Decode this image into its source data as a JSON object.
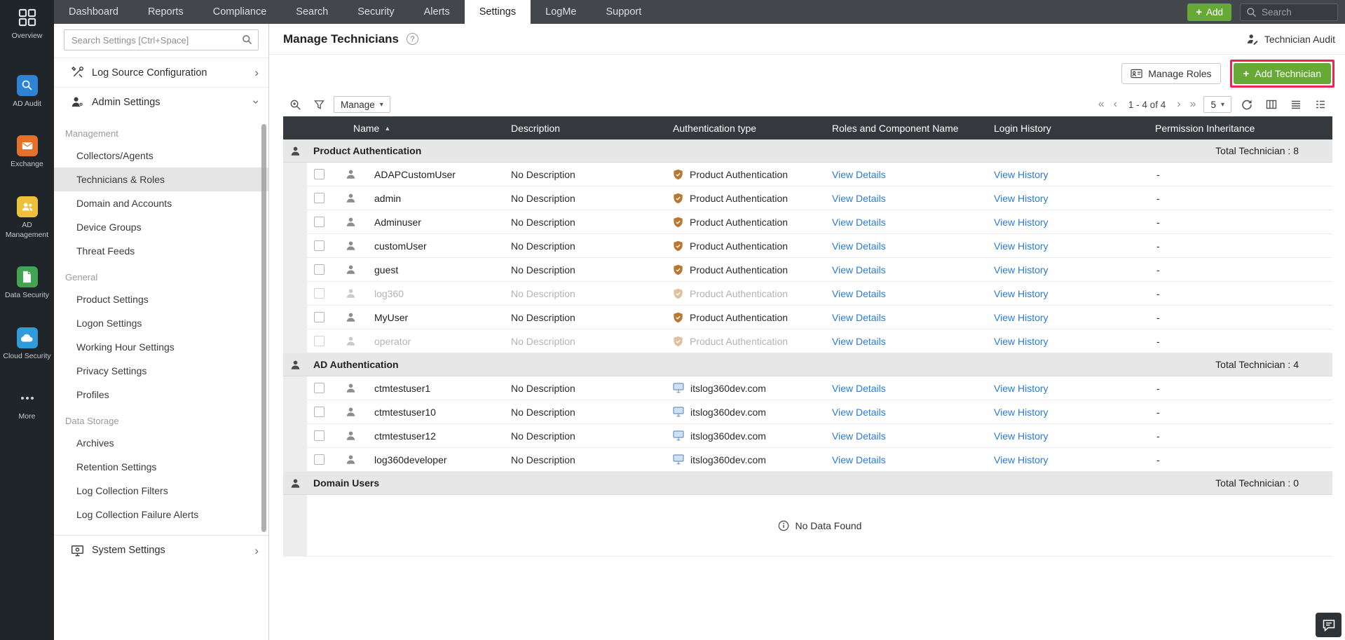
{
  "colors": {
    "accent_green": "#67a936",
    "highlight_red": "#f2244e",
    "link_blue": "#2b7bd3",
    "topbar_dark": "#43474b",
    "rail_dark": "#20252a",
    "table_header_dark": "#35393d"
  },
  "topnav": {
    "tabs": [
      {
        "label": "Dashboard",
        "active": false
      },
      {
        "label": "Reports",
        "active": false
      },
      {
        "label": "Compliance",
        "active": false
      },
      {
        "label": "Search",
        "active": false
      },
      {
        "label": "Security",
        "active": false
      },
      {
        "label": "Alerts",
        "active": false
      },
      {
        "label": "Settings",
        "active": true
      },
      {
        "label": "LogMe",
        "active": false
      },
      {
        "label": "Support",
        "active": false
      }
    ],
    "add_button_label": "Add",
    "search_placeholder": "Search"
  },
  "rail": {
    "items": [
      {
        "label": "Overview",
        "icon": "grid-icon",
        "color": ""
      },
      {
        "label": "AD Audit",
        "icon": "ad-audit-icon",
        "color": "#2e83d4"
      },
      {
        "label": "Exchange",
        "icon": "exchange-icon",
        "color": "#e5702a"
      },
      {
        "label": "AD Management",
        "icon": "ad-management-icon",
        "color": "#eec13c"
      },
      {
        "label": "Data Security",
        "icon": "data-security-icon",
        "color": "#43a353"
      },
      {
        "label": "Cloud Security",
        "icon": "cloud-security-icon",
        "color": "#2f9bd8"
      },
      {
        "label": "More",
        "icon": "more-icon",
        "color": ""
      }
    ]
  },
  "sidebar": {
    "search_placeholder": "Search Settings [Ctrl+Space]",
    "groups_top": [
      {
        "label": "Log Source Configuration",
        "icon": "tools-icon",
        "chevron": "right"
      },
      {
        "label": "Admin Settings",
        "icon": "admin-user-icon",
        "chevron": "down"
      }
    ],
    "active_item": "Technicians & Roles",
    "sections": [
      {
        "label": "Management",
        "items": [
          "Collectors/Agents",
          "Technicians & Roles",
          "Domain and Accounts",
          "Device Groups",
          "Threat Feeds"
        ]
      },
      {
        "label": "General",
        "items": [
          "Product Settings",
          "Logon Settings",
          "Working Hour Settings",
          "Privacy Settings",
          "Profiles"
        ]
      },
      {
        "label": "Data Storage",
        "items": [
          "Archives",
          "Retention Settings",
          "Log Collection Filters",
          "Log Collection Failure Alerts"
        ]
      }
    ],
    "groups_bottom": [
      {
        "label": "System Settings",
        "icon": "system-settings-icon",
        "chevron": "right"
      }
    ]
  },
  "page": {
    "title": "Manage Technicians",
    "technician_audit_label": "Technician Audit",
    "manage_roles_label": "Manage Roles",
    "add_technician_label": "Add Technician",
    "toolbar": {
      "manage_label": "Manage",
      "pagination_label": "1 - 4 of 4",
      "page_size": "5",
      "first_glyph": "«",
      "prev_glyph": "‹",
      "next_glyph": "›",
      "last_glyph": "»"
    },
    "table": {
      "columns": [
        "Name",
        "Description",
        "Authentication type",
        "Roles and Component Name",
        "Login History",
        "Permission Inheritance"
      ],
      "groups": [
        {
          "label": "Product Authentication",
          "total": "Total Technician : 8",
          "rows": [
            {
              "name": "ADAPCustomUser",
              "description": "No Description",
              "auth": "Product Authentication",
              "auth_icon": "shield-icon",
              "details": "View Details",
              "history": "View History",
              "permission": "-",
              "disabled": false
            },
            {
              "name": "admin",
              "description": "No Description",
              "auth": "Product Authentication",
              "auth_icon": "shield-icon",
              "details": "View Details",
              "history": "View History",
              "permission": "-",
              "disabled": false
            },
            {
              "name": "Adminuser",
              "description": "No Description",
              "auth": "Product Authentication",
              "auth_icon": "shield-icon",
              "details": "View Details",
              "history": "View History",
              "permission": "-",
              "disabled": false
            },
            {
              "name": "customUser",
              "description": "No Description",
              "auth": "Product Authentication",
              "auth_icon": "shield-icon",
              "details": "View Details",
              "history": "View History",
              "permission": "-",
              "disabled": false
            },
            {
              "name": "guest",
              "description": "No Description",
              "auth": "Product Authentication",
              "auth_icon": "shield-icon",
              "details": "View Details",
              "history": "View History",
              "permission": "-",
              "disabled": false
            },
            {
              "name": "log360",
              "description": "No Description",
              "auth": "Product Authentication",
              "auth_icon": "shield-icon",
              "details": "View Details",
              "history": "View History",
              "permission": "-",
              "disabled": true
            },
            {
              "name": "MyUser",
              "description": "No Description",
              "auth": "Product Authentication",
              "auth_icon": "shield-icon",
              "details": "View Details",
              "history": "View History",
              "permission": "-",
              "disabled": false
            },
            {
              "name": "operator",
              "description": "No Description",
              "auth": "Product Authentication",
              "auth_icon": "shield-icon",
              "details": "View Details",
              "history": "View History",
              "permission": "-",
              "disabled": true
            }
          ]
        },
        {
          "label": "AD Authentication",
          "total": "Total Technician : 4",
          "rows": [
            {
              "name": "ctmtestuser1",
              "description": "No Description",
              "auth": "itslog360dev.com",
              "auth_icon": "domain-icon",
              "details": "View Details",
              "history": "View History",
              "permission": "-",
              "disabled": false
            },
            {
              "name": "ctmtestuser10",
              "description": "No Description",
              "auth": "itslog360dev.com",
              "auth_icon": "domain-icon",
              "details": "View Details",
              "history": "View History",
              "permission": "-",
              "disabled": false
            },
            {
              "name": "ctmtestuser12",
              "description": "No Description",
              "auth": "itslog360dev.com",
              "auth_icon": "domain-icon",
              "details": "View Details",
              "history": "View History",
              "permission": "-",
              "disabled": false
            },
            {
              "name": "log360developer",
              "description": "No Description",
              "auth": "itslog360dev.com",
              "auth_icon": "domain-icon",
              "details": "View Details",
              "history": "View History",
              "permission": "-",
              "disabled": false
            }
          ]
        },
        {
          "label": "Domain Users",
          "total": "Total Technician : 0",
          "rows": [],
          "empty_text": "No Data Found"
        }
      ]
    }
  }
}
